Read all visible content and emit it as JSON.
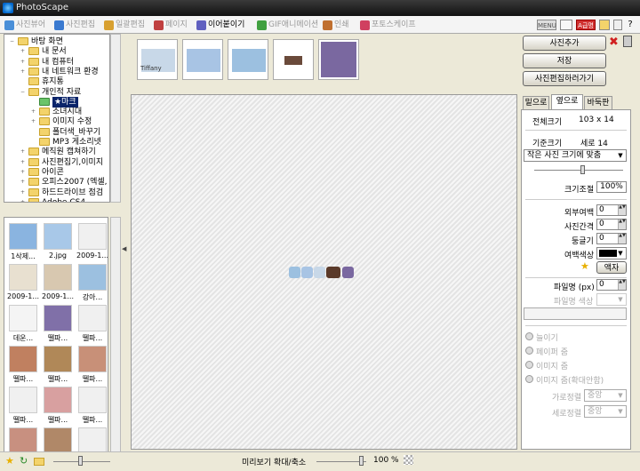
{
  "app": {
    "title": "PhotoScape"
  },
  "tabs": [
    {
      "label": "사진뷰어",
      "color": "#4a8fd8"
    },
    {
      "label": "사진편집",
      "color": "#3a7ad0"
    },
    {
      "label": "일괄편집",
      "color": "#d8a030"
    },
    {
      "label": "페이지",
      "color": "#c04040"
    },
    {
      "label": "이어붙이기",
      "color": "#6060c0"
    },
    {
      "label": "GIF애니메이션",
      "color": "#40a040"
    },
    {
      "label": "인쇄",
      "color": "#c07030"
    },
    {
      "label": "포토스케이프",
      "color": "#d04060"
    }
  ],
  "topright": {
    "menu": "MENU",
    "badge": "A급명",
    "help": "?"
  },
  "tree": [
    {
      "label": "바탕 화면",
      "depth": 0,
      "exp": "−"
    },
    {
      "label": "내 문서",
      "depth": 1,
      "exp": "+"
    },
    {
      "label": "내 컴퓨터",
      "depth": 1,
      "exp": "+"
    },
    {
      "label": "내 네트워크 환경",
      "depth": 1,
      "exp": "+"
    },
    {
      "label": "휴지통",
      "depth": 1,
      "exp": ""
    },
    {
      "label": "개인적 자료",
      "depth": 1,
      "exp": "−"
    },
    {
      "label": "★마크",
      "depth": 2,
      "exp": "",
      "selected": true
    },
    {
      "label": "소녀시대",
      "depth": 2,
      "exp": "+"
    },
    {
      "label": "이미지 수정",
      "depth": 2,
      "exp": "+"
    },
    {
      "label": "폴더색_바꾸기",
      "depth": 2,
      "exp": ""
    },
    {
      "label": "MP3 게소리넷",
      "depth": 2,
      "exp": ""
    },
    {
      "label": "메직원 캡쳐하기",
      "depth": 1,
      "exp": "+"
    },
    {
      "label": "사진편집기,이미지",
      "depth": 1,
      "exp": "+"
    },
    {
      "label": "아이콘",
      "depth": 1,
      "exp": "+"
    },
    {
      "label": "오피스2007 (엑셀,",
      "depth": 1,
      "exp": "+"
    },
    {
      "label": "하드드라이브 점검",
      "depth": 1,
      "exp": "+"
    },
    {
      "label": "Adobe CS4",
      "depth": 1,
      "exp": "+"
    }
  ],
  "thumbs": [
    {
      "caption": "1삭제...",
      "color": "#8ab4e0"
    },
    {
      "caption": "2.jpg",
      "color": "#a8c8e8"
    },
    {
      "caption": "2009-1...",
      "color": "#f0f0f0"
    },
    {
      "caption": "2009-1...",
      "color": "#e8e0d0"
    },
    {
      "caption": "2009-1...",
      "color": "#d8c8b0"
    },
    {
      "caption": "강아...",
      "color": "#9cc0e0"
    },
    {
      "caption": "데운...",
      "color": "#f4f4f4"
    },
    {
      "caption": "뗄파...",
      "color": "#8070a8"
    },
    {
      "caption": "뗄파...",
      "color": "#f0f0f0"
    },
    {
      "caption": "뗄파...",
      "color": "#c08060"
    },
    {
      "caption": "뗄파...",
      "color": "#b08858"
    },
    {
      "caption": "뗄파...",
      "color": "#c89078"
    },
    {
      "caption": "뗄파...",
      "color": "#f0f0f0"
    },
    {
      "caption": "뗄파...",
      "color": "#d8a0a0"
    },
    {
      "caption": "뗄파...",
      "color": "#f0f0f0"
    },
    {
      "caption": "",
      "color": "#c89080"
    },
    {
      "caption": "",
      "color": "#b08868"
    },
    {
      "caption": "",
      "color": "#f0f0f0"
    }
  ],
  "filmstrip": [
    {
      "label": "Tiffany",
      "color": "#c8d8e8"
    },
    {
      "label": "",
      "color": "#a8c4e4"
    },
    {
      "label": "",
      "color": "#9cc0e0"
    },
    {
      "label": "",
      "color": "#6a4a3a"
    },
    {
      "label": "",
      "color": "#7a68a0"
    }
  ],
  "buttons": {
    "add": "사진추가",
    "save": "저장",
    "edit": "사진편집하러가기"
  },
  "right_tabs": [
    "밑으로",
    "옆으로",
    "바둑판"
  ],
  "right_panel": {
    "total_size_label": "전체크기",
    "total_size_value": "103 x 14",
    "base_size_label": "기준크기",
    "base_size_value": "세로 14",
    "fit_option": "작은 사진 크기에 맞춤",
    "zoom_label": "크기조절",
    "zoom_value": "100%",
    "outer_margin_label": "외부여백",
    "outer_margin_value": "0",
    "spacing_label": "사진간격",
    "spacing_value": "0",
    "round_label": "둥글기",
    "round_value": "0",
    "margin_color_label": "여백색상",
    "frame_button": "액자",
    "filename_label": "파일명 (px)",
    "filename_value": "0",
    "filename_color_label": "파일명 색상",
    "radios": [
      "늘이기",
      "페이퍼 줌",
      "이미지 줌",
      "이미지 줌(확대안함)"
    ],
    "halign_label": "가로정렬",
    "halign_value": "중앙",
    "valign_label": "세로정렬",
    "valign_value": "중앙"
  },
  "bottom": {
    "preview_label": "미리보기 확대/축소",
    "zoom_value": "100 %"
  }
}
